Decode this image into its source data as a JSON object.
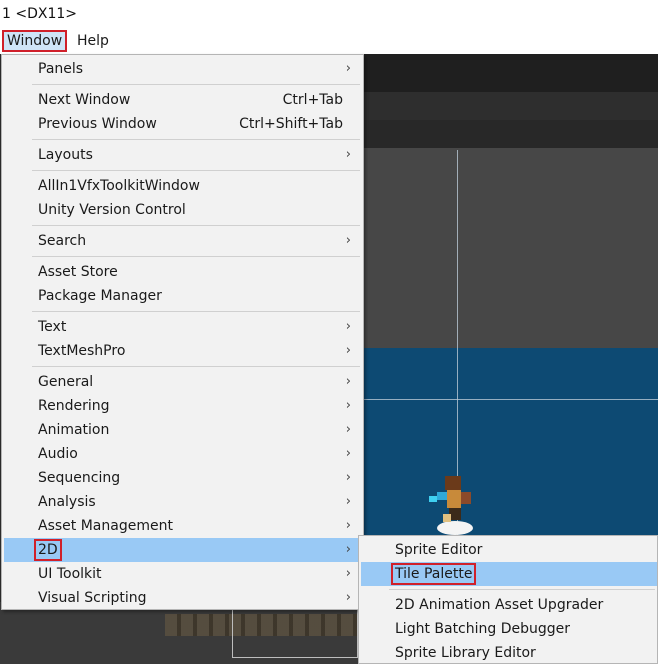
{
  "window": {
    "title": "1 <DX11>"
  },
  "menubar": {
    "window_label": "Window",
    "help_label": "Help"
  },
  "menu": {
    "panels": "Panels",
    "next_window": "Next Window",
    "next_window_sc": "Ctrl+Tab",
    "prev_window": "Previous Window",
    "prev_window_sc": "Ctrl+Shift+Tab",
    "layouts": "Layouts",
    "allin1": "AllIn1VfxToolkitWindow",
    "unity_vc": "Unity Version Control",
    "search": "Search",
    "asset_store": "Asset Store",
    "package_manager": "Package Manager",
    "text": "Text",
    "textmeshpro": "TextMeshPro",
    "general": "General",
    "rendering": "Rendering",
    "animation": "Animation",
    "audio": "Audio",
    "sequencing": "Sequencing",
    "analysis": "Analysis",
    "asset_management": "Asset Management",
    "two_d": "2D",
    "ui_toolkit": "UI Toolkit",
    "visual_scripting": "Visual Scripting",
    "arrow": "›"
  },
  "submenu": {
    "sprite_editor": "Sprite Editor",
    "tile_palette": "Tile Palette",
    "anim_upgrader": "2D Animation Asset Upgrader",
    "light_debugger": "Light Batching Debugger",
    "sprite_library": "Sprite Library Editor"
  },
  "colors": {
    "highlight": "#99c9f5",
    "annotation": "#d0202a",
    "scene_blue": "#0d4a73"
  }
}
